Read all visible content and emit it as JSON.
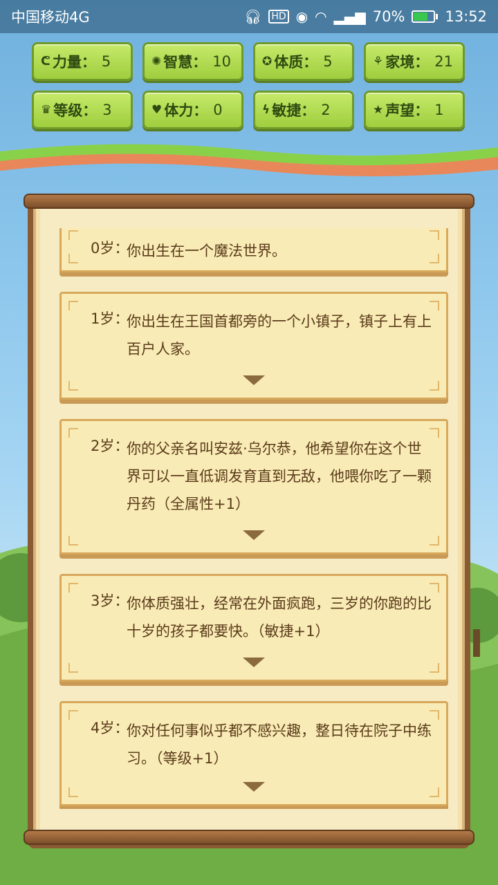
{
  "status_bar": {
    "carrier": "中国移动4G",
    "icons": [
      "headset-icon",
      "hd-icon",
      "eye-icon",
      "wifi-icon",
      "4g-signal-icon"
    ],
    "battery_percent": "70%",
    "battery_level": 0.7,
    "time": "13:52"
  },
  "stats": [
    {
      "icon": "muscle-icon",
      "glyph": "ᕦ",
      "label": "力量：",
      "value": "5"
    },
    {
      "icon": "bulb-icon",
      "glyph": "✺",
      "label": "智慧：",
      "value": "10"
    },
    {
      "icon": "body-icon",
      "glyph": "✪",
      "label": "体质：",
      "value": "5"
    },
    {
      "icon": "money-bag-icon",
      "glyph": "⚘",
      "label": "家境：",
      "value": "21"
    },
    {
      "icon": "crown-icon",
      "glyph": "♛",
      "label": "等级：",
      "value": "3"
    },
    {
      "icon": "heart-icon",
      "glyph": "♥",
      "label": "体力：",
      "value": "0"
    },
    {
      "icon": "lightning-icon",
      "glyph": "ϟ",
      "label": "敏捷：",
      "value": "2"
    },
    {
      "icon": "star-icon",
      "glyph": "★",
      "label": "声望：",
      "value": "1"
    }
  ],
  "entries": [
    {
      "age": "0岁：",
      "text": "你出生在一个魔法世界。",
      "has_arrow": false
    },
    {
      "age": "1岁：",
      "text": "你出生在王国首都旁的一个小镇子，镇子上有上百户人家。",
      "has_arrow": true
    },
    {
      "age": "2岁：",
      "text": "你的父亲名叫安兹·乌尔恭，他希望你在这个世界可以一直低调发育直到无敌，他喂你吃了一颗丹药（全属性+1）",
      "has_arrow": true
    },
    {
      "age": "3岁：",
      "text": "你体质强壮，经常在外面疯跑，三岁的你跑的比十岁的孩子都要快。（敏捷+1）",
      "has_arrow": true
    },
    {
      "age": "4岁：",
      "text": "你对任何事似乎都不感兴趣，整日待在院子中练习。（等级+1）",
      "has_arrow": true
    }
  ]
}
